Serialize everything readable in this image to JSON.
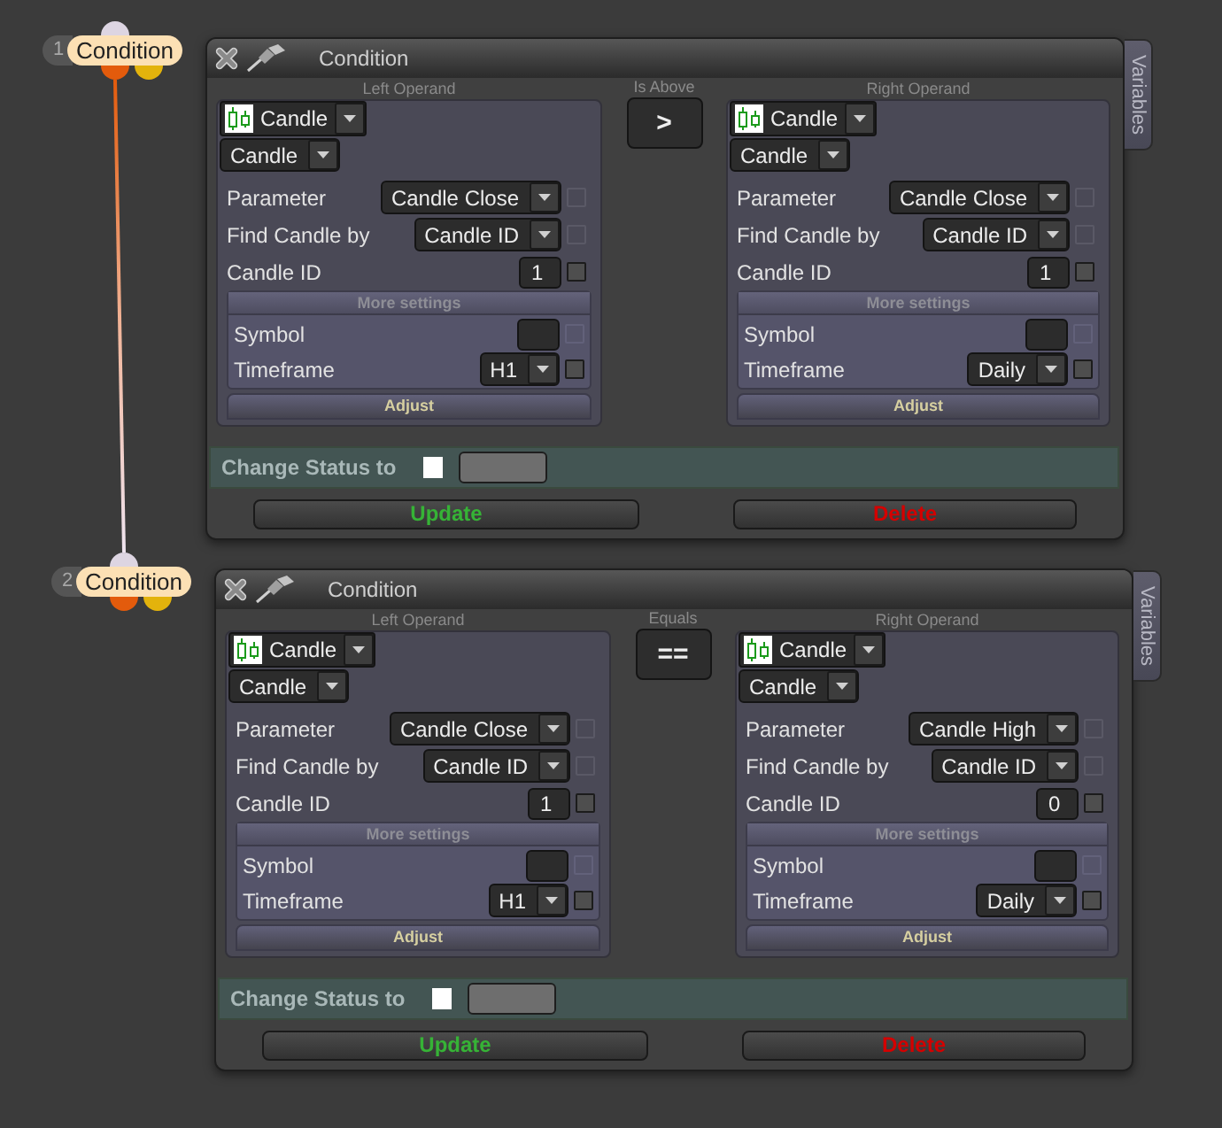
{
  "conditions": [
    {
      "number": "1",
      "label": "Condition",
      "ports": [
        {
          "kind": "input",
          "color": "#ddd5e2"
        },
        {
          "kind": "output",
          "color": "#e35b0c"
        },
        {
          "kind": "output",
          "color": "#e3b30c"
        }
      ],
      "window": {
        "title": "Condition",
        "side_tab": "Variables",
        "left_operand": {
          "heading": "Left Operand",
          "source": "Candle",
          "type": "Candle",
          "fields": [
            {
              "kind": "select",
              "label": "Parameter",
              "value": "Candle Close",
              "checkbox": {
                "checked": false,
                "disabled": true
              }
            },
            {
              "kind": "select",
              "label": "Find Candle by",
              "value": "Candle ID",
              "checkbox": {
                "checked": false,
                "disabled": true
              }
            },
            {
              "kind": "input",
              "label": "Candle ID",
              "value": "1",
              "checkbox": {
                "checked": false,
                "disabled": false
              }
            }
          ],
          "more_settings": {
            "heading": "More settings",
            "fields": [
              {
                "kind": "input",
                "label": "Symbol",
                "checkbox": {
                  "checked": false,
                  "disabled": true
                }
              },
              {
                "kind": "select",
                "label": "Timeframe",
                "value": "H1",
                "checkbox": {
                  "checked": false,
                  "disabled": false
                }
              }
            ]
          },
          "adjust": "Adjust"
        },
        "operator": {
          "label": "Is Above",
          "symbol": ">"
        },
        "right_operand": {
          "heading": "Right Operand",
          "source": "Candle",
          "type": "Candle",
          "fields": [
            {
              "kind": "select",
              "label": "Parameter",
              "value": "Candle Close",
              "checkbox": {
                "checked": false,
                "disabled": true
              }
            },
            {
              "kind": "select",
              "label": "Find Candle by",
              "value": "Candle ID",
              "checkbox": {
                "checked": false,
                "disabled": true
              }
            },
            {
              "kind": "input",
              "label": "Candle ID",
              "value": "1",
              "checkbox": {
                "checked": false,
                "disabled": false
              }
            }
          ],
          "more_settings": {
            "heading": "More settings",
            "fields": [
              {
                "kind": "input",
                "label": "Symbol",
                "checkbox": {
                  "checked": false,
                  "disabled": true
                }
              },
              {
                "kind": "select",
                "label": "Timeframe",
                "value": "Daily",
                "checkbox": {
                  "checked": false,
                  "disabled": false
                }
              }
            ]
          },
          "adjust": "Adjust"
        },
        "change_status": {
          "label": "Change Status to",
          "checked": false
        },
        "buttons": [
          {
            "kind": "update",
            "label": "Update"
          },
          {
            "kind": "delete",
            "label": "Delete"
          }
        ]
      }
    },
    {
      "number": "2",
      "label": "Condition",
      "ports": [
        {
          "kind": "input",
          "color": "#ddd5e2"
        },
        {
          "kind": "output",
          "color": "#e35b0c"
        },
        {
          "kind": "output",
          "color": "#e3b30c"
        }
      ],
      "window": {
        "title": "Condition",
        "side_tab": "Variables",
        "left_operand": {
          "heading": "Left Operand",
          "source": "Candle",
          "type": "Candle",
          "fields": [
            {
              "kind": "select",
              "label": "Parameter",
              "value": "Candle Close",
              "checkbox": {
                "checked": false,
                "disabled": true
              }
            },
            {
              "kind": "select",
              "label": "Find Candle by",
              "value": "Candle ID",
              "checkbox": {
                "checked": false,
                "disabled": true
              }
            },
            {
              "kind": "input",
              "label": "Candle ID",
              "value": "1",
              "checkbox": {
                "checked": false,
                "disabled": false
              }
            }
          ],
          "more_settings": {
            "heading": "More settings",
            "fields": [
              {
                "kind": "input",
                "label": "Symbol",
                "checkbox": {
                  "checked": false,
                  "disabled": true
                }
              },
              {
                "kind": "select",
                "label": "Timeframe",
                "value": "H1",
                "checkbox": {
                  "checked": false,
                  "disabled": false
                }
              }
            ]
          },
          "adjust": "Adjust"
        },
        "operator": {
          "label": "Equals",
          "symbol": "=="
        },
        "right_operand": {
          "heading": "Right Operand",
          "source": "Candle",
          "type": "Candle",
          "fields": [
            {
              "kind": "select",
              "label": "Parameter",
              "value": "Candle High",
              "checkbox": {
                "checked": false,
                "disabled": true
              }
            },
            {
              "kind": "select",
              "label": "Find Candle by",
              "value": "Candle ID",
              "checkbox": {
                "checked": false,
                "disabled": true
              }
            },
            {
              "kind": "input",
              "label": "Candle ID",
              "value": "0",
              "checkbox": {
                "checked": false,
                "disabled": false
              }
            }
          ],
          "more_settings": {
            "heading": "More settings",
            "fields": [
              {
                "kind": "input",
                "label": "Symbol",
                "checkbox": {
                  "checked": false,
                  "disabled": true
                }
              },
              {
                "kind": "select",
                "label": "Timeframe",
                "value": "Daily",
                "checkbox": {
                  "checked": false,
                  "disabled": false
                }
              }
            ]
          },
          "adjust": "Adjust"
        },
        "change_status": {
          "label": "Change Status to",
          "checked": false
        },
        "buttons": [
          {
            "kind": "update",
            "label": "Update"
          },
          {
            "kind": "delete",
            "label": "Delete"
          }
        ]
      }
    }
  ]
}
